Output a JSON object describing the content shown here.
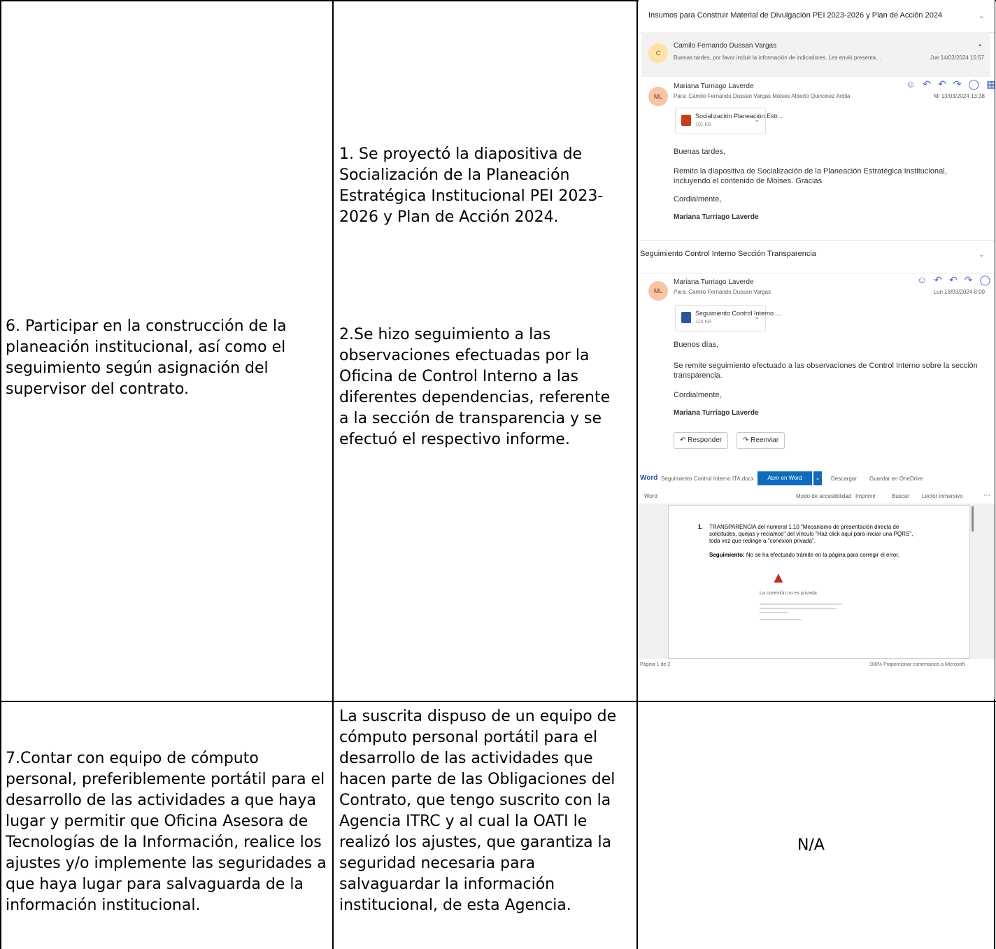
{
  "rows": [
    {
      "obligation": "6.        Participar en la construcción de la planeación institucional, así como el seguimiento según asignación del supervisor del contrato.",
      "activity_1": "1. Se proyectó la diapositiva de Socialización de la Planeación Estratégica Institucional PEI 2023-2026 y Plan de Acción 2024.",
      "activity_2": "2.Se hizo seguimiento a las observaciones efectuadas por la Oficina de Control Interno a las diferentes dependencias, referente a la sección de transparencia y se efectuó el respectivo informe."
    },
    {
      "obligation": "7.Contar con equipo de cómputo personal, preferiblemente portátil para el desarrollo de las actividades a que haya lugar y permitir que Oficina Asesora de Tecnologías de la Información, realice los ajustes y/o implemente las seguridades a que haya lugar para salvaguarda de la información institucional.",
      "activity": "La suscrita dispuso de un equipo de cómputo personal portátil para el desarrollo de las actividades que hacen parte de las Obligaciones del Contrato, que tengo suscrito con la Agencia ITRC y al cual la OATI le realizó los ajustes, que garantiza la seguridad necesaria para salvaguardar la información institucional, de esta Agencia.",
      "evidence": "N/A"
    }
  ],
  "email1": {
    "subject": "Insumos para Construir Material de Divulgación PEI 2023-2026 y Plan de Acción 2024",
    "collapsed_sender": "Camilo Fernando Dussan Vargas",
    "collapsed_avatar": "C",
    "collapsed_preview": "Buenas tardes, por favor incluir la información de indicadores. Les envió presentaci...",
    "collapsed_date": "Jue 14/03/2024 15:57",
    "sender": "Mariana Turriago Laverde",
    "avatar": "ML",
    "to": "Para:  Camilo Fernando Dussan Vargas   Moises Alberto Quinonez Ardila",
    "date": "Mi 13/03/2024 13:38",
    "attachment_name": "Socialización Planeación Estr...",
    "attachment_size": "101 KB",
    "greeting": "Buenas tardes,",
    "body": "Remito la diapositiva de Socialización de la Planeación Estratégica Institucional,\nincluyendo el contenido de Moises. Gracias",
    "closing": "Cordialmente,",
    "signature": "Mariana Turriago Laverde"
  },
  "email2": {
    "subject": "Seguimiento Control Interno Sección Transparencia",
    "sender": "Mariana Turriago Laverde",
    "avatar": "ML",
    "to": "Para:  Camilo Fernando Dussan Vargas",
    "date": "Lun 18/03/2024 8:00",
    "attachment_name": "Seguimiento Control Interno ...",
    "attachment_size": "125 KB",
    "greeting": "Buenos días,",
    "body": "Se remite seguimiento efectuado a las observaciones de Control Interno sobre la sección\ntransparencia.",
    "closing": "Cordialmente,",
    "signature": "Mariana Turriago Laverde",
    "reply_label": "Responder",
    "forward_label": "Reenviar"
  },
  "word_viewer": {
    "app": "Word",
    "doc_name": "Seguimiento Control Interno ITA.docx",
    "open_label": "Abrir en Word",
    "download_label": "Descargar",
    "save_label": "Guardar en OneDrive",
    "word_label": "Word",
    "accessibility_label": "Modo de accesibilidad",
    "print_label": "Imprimir",
    "search_label": "Buscar",
    "reader_label": "Lector inmersivo",
    "item_number": "1.",
    "item_text": "TRANSPARENCIA del numeral 1.10 \"Mecanismo de presentación directa de solicitudes, quejas y reclamos\" del vínculo \"Haz click aquí para iniciar una PQRS\", toda vez que redirige a \"conexión privada\".",
    "followup_label": "Seguimiento:",
    "followup_text": " No se ha efectuado trámite en la página para corregir el error.",
    "warning_title": "La conexión no es privada",
    "page_info": "Página 1 de 2",
    "zoom": "100%",
    "footer_right": "Proporcionar comentarios a Microsoft",
    "colors": {
      "word_blue": "#2b579a",
      "open_btn": "#0f6cbd",
      "warning": "#c42b1c"
    }
  }
}
